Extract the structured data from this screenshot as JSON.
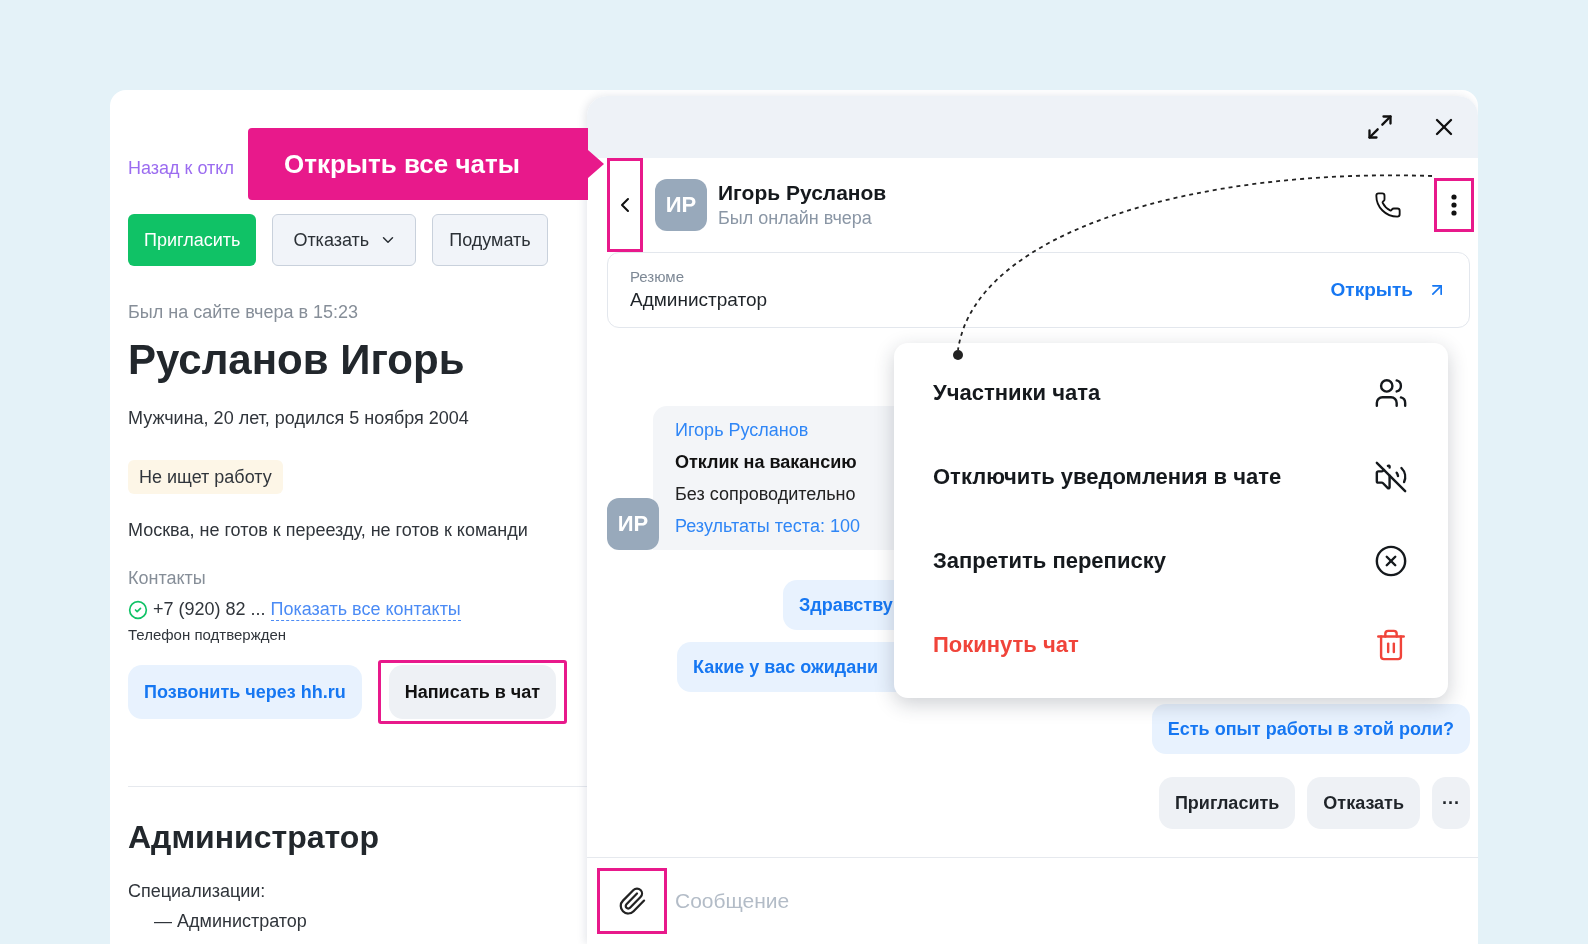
{
  "callout": {
    "label": "Открыть все чаты"
  },
  "profile": {
    "back_link": "Назад к откл",
    "actions": [
      {
        "label": "Пригласить",
        "kind": "primary"
      },
      {
        "label": "Отказать",
        "kind": "dropdown"
      },
      {
        "label": "Подумать",
        "kind": "secondary"
      }
    ],
    "last_seen": "Был на сайте вчера в 15:23",
    "name": "Русланов Игорь",
    "details": "Мужчина, 20 лет, родился 5 ноября 2004",
    "status_tag": "Не ищет работу",
    "location": "Москва, не готов к переезду, не готов к команди",
    "contacts_label": "Контакты",
    "phone": "+7 (920) 82 ...",
    "phone_verified": true,
    "show_contacts": "Показать все контакты",
    "phone_note": "Телефон подтвержден",
    "contact_buttons": [
      {
        "label": "Позвонить через hh.ru",
        "kind": "call",
        "highlighted": false
      },
      {
        "label": "Написать в чат",
        "kind": "chat",
        "highlighted": true
      }
    ],
    "position": "Администратор",
    "specializations_label": "Специализации:",
    "specializations": [
      "— Администратор"
    ]
  },
  "chat": {
    "back_highlighted": true,
    "avatar": "ИР",
    "name": "Игорь Русланов",
    "status": "Был онлайн вчера",
    "more_highlighted": true,
    "resume": {
      "label": "Резюме",
      "title": "Администратор",
      "open": "Открыть"
    },
    "messages": [
      {
        "kind": "incoming",
        "avatar": "ИР",
        "lines": [
          {
            "kind": "author",
            "text": "Игорь Русланов"
          },
          {
            "kind": "title",
            "text": "Отклик на вакансию"
          },
          {
            "kind": "text",
            "text": "Без сопроводительно"
          },
          {
            "kind": "link",
            "text": "Результаты теста: 100"
          }
        ]
      },
      {
        "kind": "outgoing",
        "text": "Здравству"
      },
      {
        "kind": "outgoing",
        "text": "Какие у вас ожидани"
      },
      {
        "kind": "outgoing",
        "text": "Есть опыт работы в этой роли?"
      }
    ],
    "quick_actions": [
      "Пригласить",
      "Отказать",
      "···"
    ],
    "input": {
      "placeholder": "Сообщение",
      "attach_highlighted": true
    },
    "menu": [
      {
        "label": "Участники чата",
        "destructive": false
      },
      {
        "label": "Отключить уведомления в чате",
        "destructive": false
      },
      {
        "label": "Запретить переписку",
        "destructive": false
      },
      {
        "label": "Покинуть чат",
        "destructive": true
      }
    ]
  }
}
